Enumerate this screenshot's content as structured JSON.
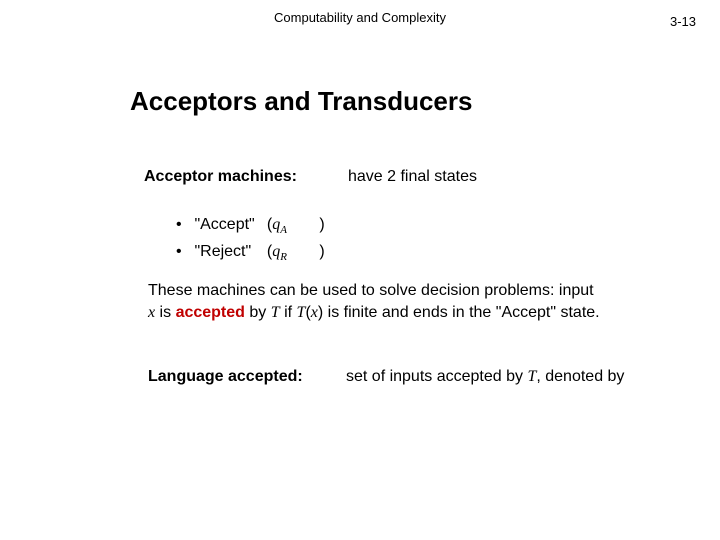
{
  "header": {
    "course": "Computability and Complexity",
    "page": "3-13"
  },
  "title": "Acceptors and Transducers",
  "acceptor": {
    "label": "Acceptor machines:",
    "desc": "have 2 final states"
  },
  "bullets": {
    "dot": "•",
    "items": [
      {
        "name": "\"Accept\"",
        "open": "(",
        "sym": "q",
        "sub": "A",
        "close": ")"
      },
      {
        "name": "\"Reject\"",
        "open": "(",
        "sym": "q",
        "sub": "R",
        "close": ")"
      }
    ]
  },
  "paragraph": {
    "t1": "These machines can be used to solve decision problems: input ",
    "x": "x",
    "t2": " is ",
    "accepted": "accepted",
    "t3": " by ",
    "T1": "T",
    "t4": " if ",
    "T2": "T",
    "lp": "(",
    "x2": "x",
    "rp": ")",
    "t5": " is finite and ends in the \"Accept\" state."
  },
  "language": {
    "label": "Language accepted:",
    "d1": "set of inputs accepted by ",
    "T": "T",
    "d2": ", denoted by"
  }
}
